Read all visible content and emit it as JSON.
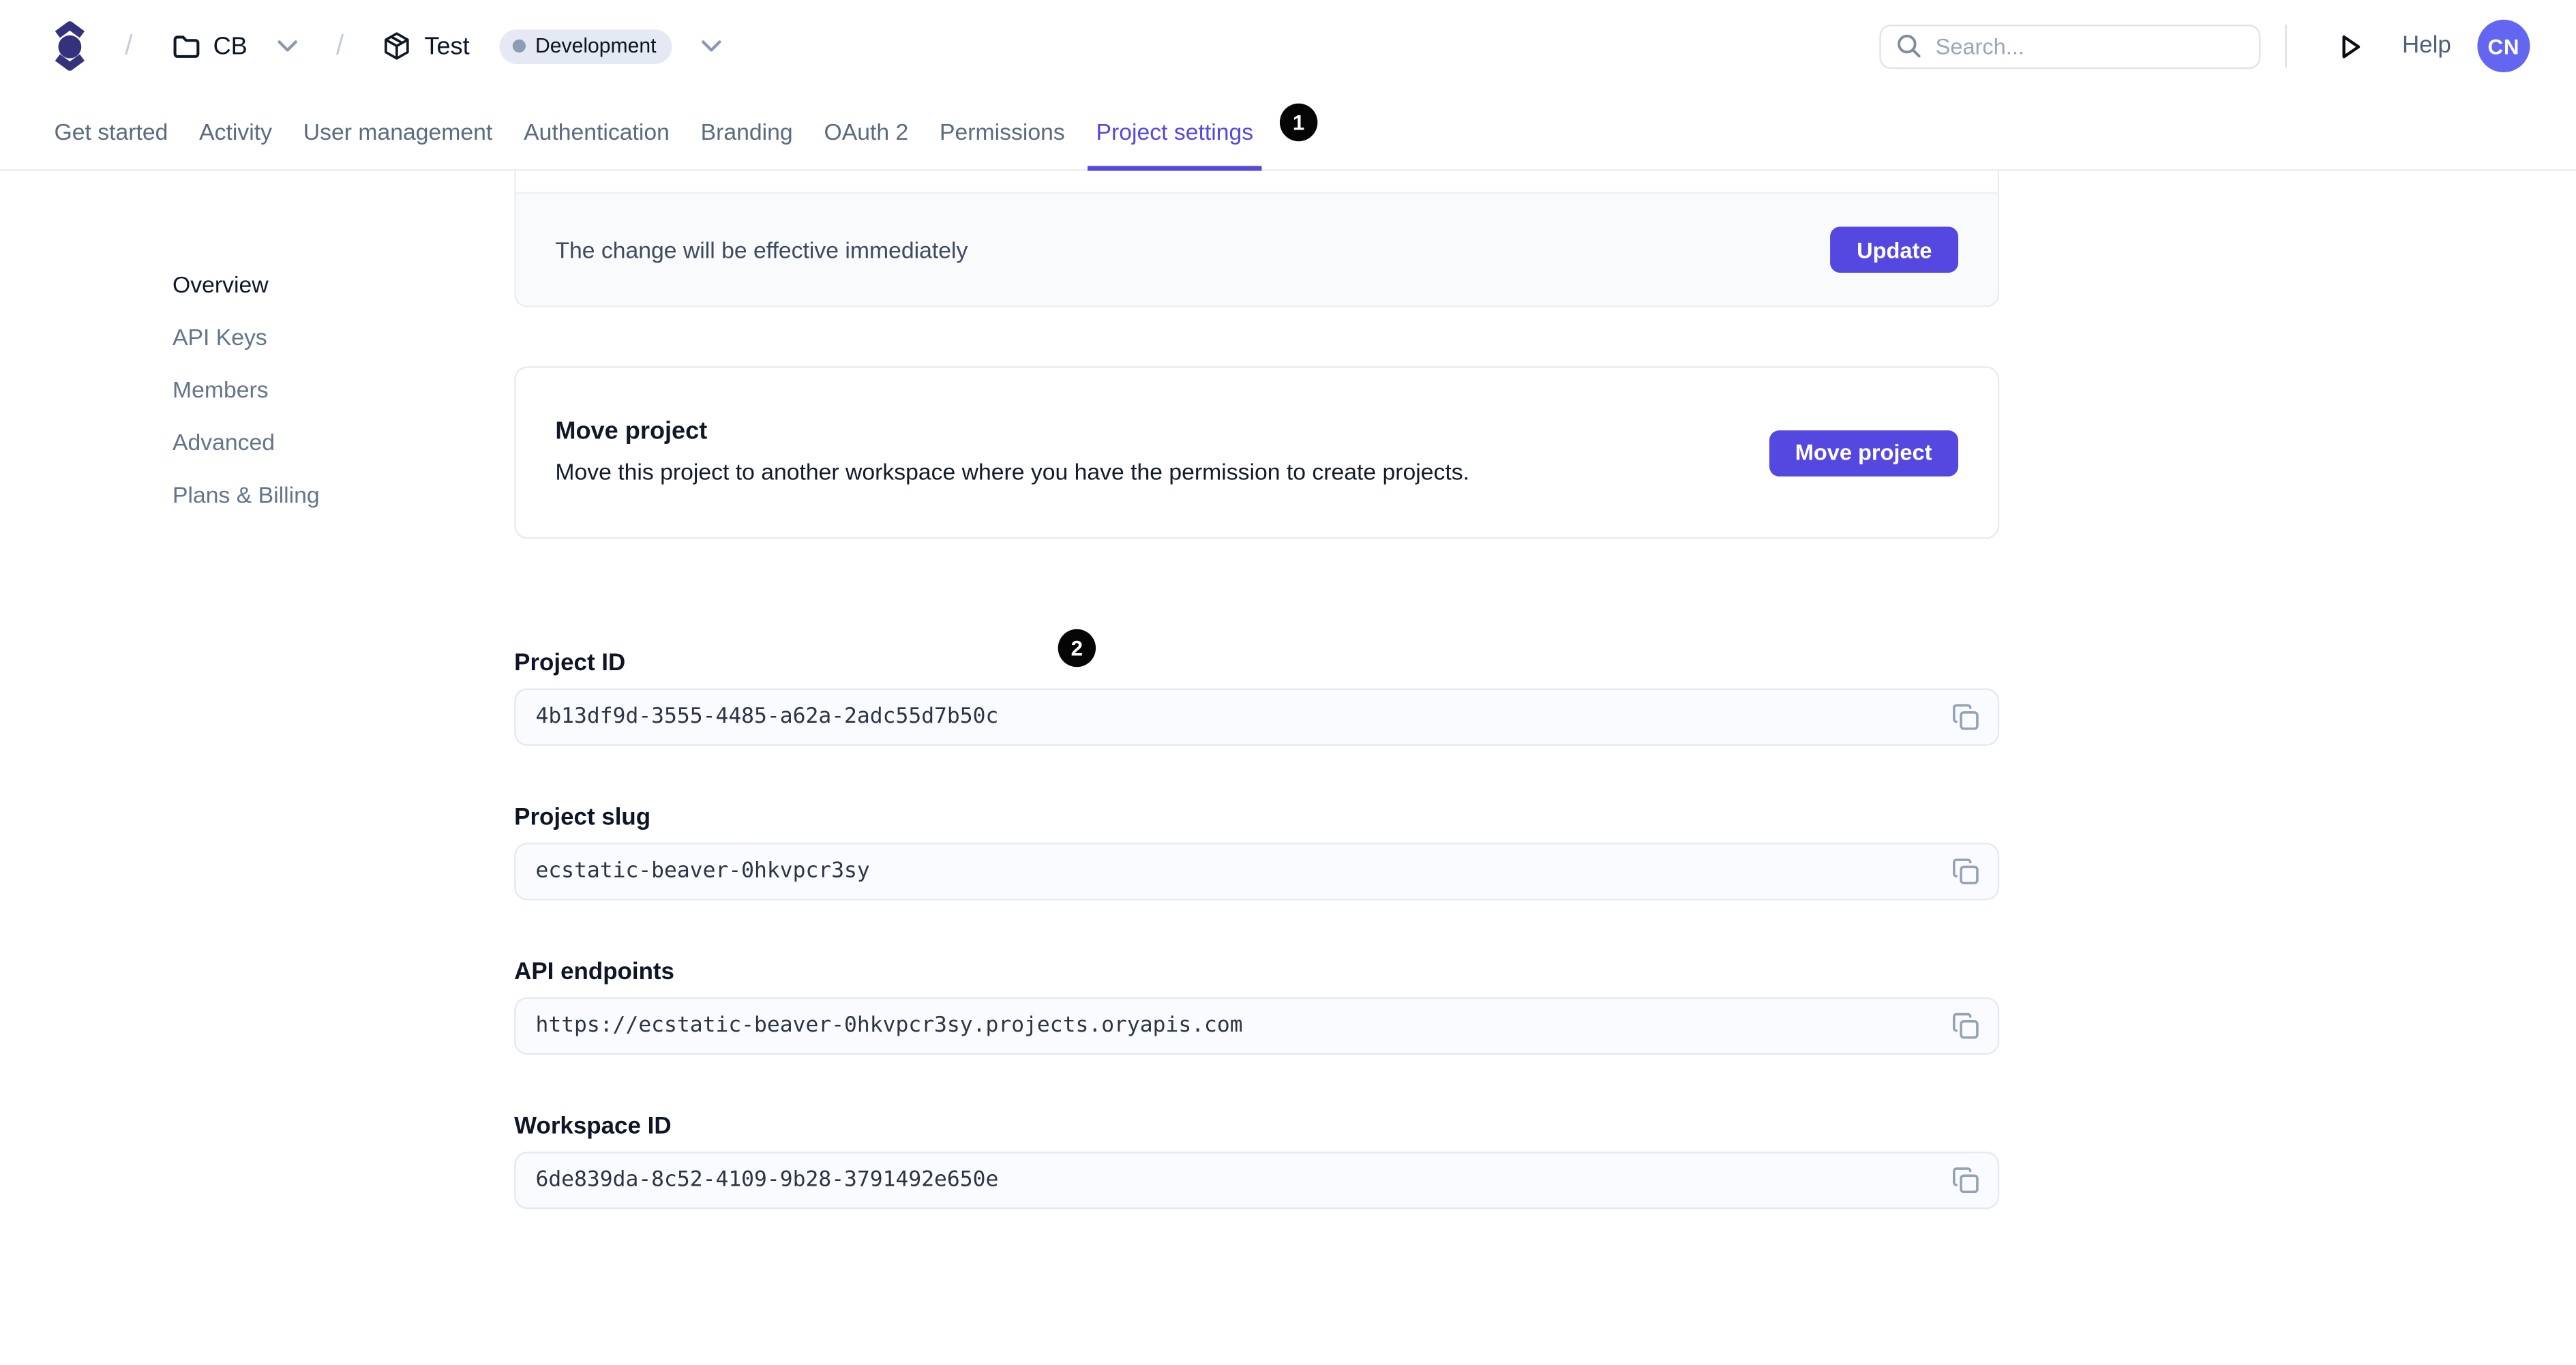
{
  "header": {
    "breadcrumb": {
      "separator": "/",
      "workspace": "CB",
      "project": "Test",
      "environment": "Development"
    },
    "search": {
      "placeholder": "Search..."
    },
    "help": "Help",
    "avatar": "CN"
  },
  "tabs": [
    "Get started",
    "Activity",
    "User management",
    "Authentication",
    "Branding",
    "OAuth 2",
    "Permissions",
    "Project settings"
  ],
  "active_tab": "Project settings",
  "annotations": {
    "step1": "1",
    "step2": "2"
  },
  "sidebar": [
    "Overview",
    "API Keys",
    "Members",
    "Advanced",
    "Plans & Billing"
  ],
  "active_sidebar": "Overview",
  "content": {
    "update_card": {
      "note": "The change will be effective immediately",
      "button": "Update"
    },
    "move_card": {
      "title": "Move project",
      "description": "Move this project to another workspace where you have the permission to create projects.",
      "button": "Move project"
    },
    "fields": [
      {
        "label": "Project ID",
        "value": "4b13df9d-3555-4485-a62a-2adc55d7b50c"
      },
      {
        "label": "Project slug",
        "value": "ecstatic-beaver-0hkvpcr3sy"
      },
      {
        "label": "API endpoints",
        "value": "https://ecstatic-beaver-0hkvpcr3sy.projects.oryapis.com"
      },
      {
        "label": "Workspace ID",
        "value": "6de839da-8c52-4109-9b28-3791492e650e"
      }
    ]
  },
  "colors": {
    "primary": "#5548e0",
    "avatar": "#6366f1",
    "logo": "#34327c",
    "annotation_badge": "#050505",
    "env_badge_bg": "#e4e9f3"
  }
}
